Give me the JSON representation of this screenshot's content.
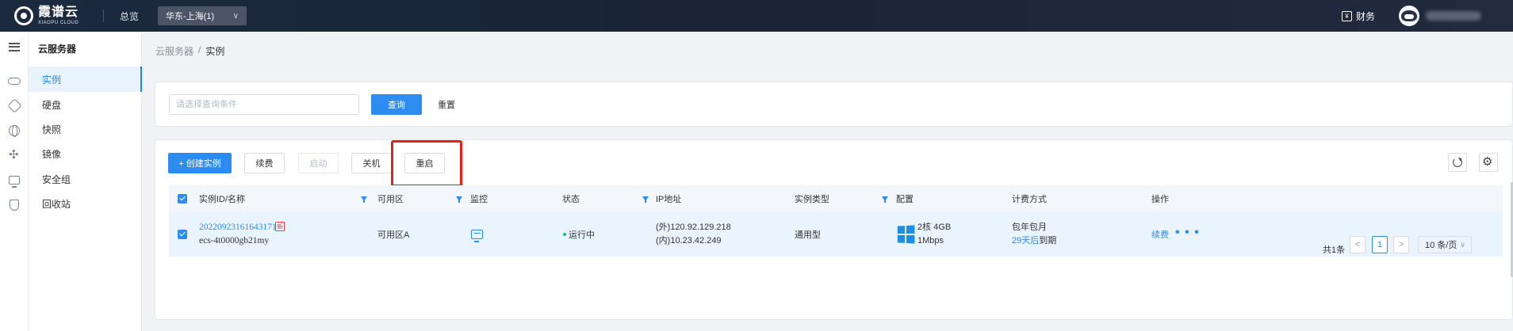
{
  "topbar": {
    "logo_text": "霞谱云",
    "logo_sub": "XIAOPU CLOUD",
    "overview": "总览",
    "region": "华东-上海(1)",
    "finance": "财务"
  },
  "sidebar": {
    "title": "云服务器",
    "items": [
      {
        "label": "实例",
        "icon": "cloud-server-icon",
        "active": true
      },
      {
        "label": "硬盘",
        "icon": "disk-icon"
      },
      {
        "label": "快照",
        "icon": "globe-icon"
      },
      {
        "label": "镜像",
        "icon": "network-icon"
      },
      {
        "label": "安全组",
        "icon": "monitor-icon"
      },
      {
        "label": "回收站",
        "icon": "shield-icon"
      }
    ]
  },
  "breadcrumb": {
    "parent": "云服务器",
    "separator": "/",
    "current": "实例"
  },
  "search": {
    "placeholder": "请选择查询条件",
    "value": "",
    "query_label": "查询",
    "reset_label": "重置"
  },
  "toolbar": {
    "create_label": "+ 创建实例",
    "renew_label": "续费",
    "start_label": "启动",
    "shutdown_label": "关机",
    "restart_label": "重启"
  },
  "table": {
    "headers": {
      "id_name": "实例ID/名称",
      "zone": "可用区",
      "monitor": "监控",
      "status": "状态",
      "ip": "IP地址",
      "instance_type": "实例类型",
      "config": "配置",
      "billing": "计费方式",
      "actions": "操作"
    },
    "rows": [
      {
        "id": "20220923161643171",
        "new_badge": "新",
        "name": "ecs-4t0000gb21my",
        "zone": "可用区A",
        "status": "运行中",
        "ip_external": "(外)120.92.129.218",
        "ip_internal": "(内)10.23.42.249",
        "instance_type": "通用型",
        "config_cpu_mem": "2核 4GB",
        "config_bandwidth": "1Mbps",
        "billing_type": "包年包月",
        "expire_days": "29天后",
        "expire_suffix": "到期",
        "renew_action": "续费",
        "more_action": "• • •"
      }
    ]
  },
  "pagination": {
    "total": "共1条",
    "prev": "<",
    "current_page": "1",
    "next": ">",
    "page_size": "10 条/页"
  },
  "colors": {
    "primary": "#2d8cf0",
    "status_running": "#19be6b",
    "highlight": "#e8201a",
    "new_badge": "#e8453c"
  }
}
